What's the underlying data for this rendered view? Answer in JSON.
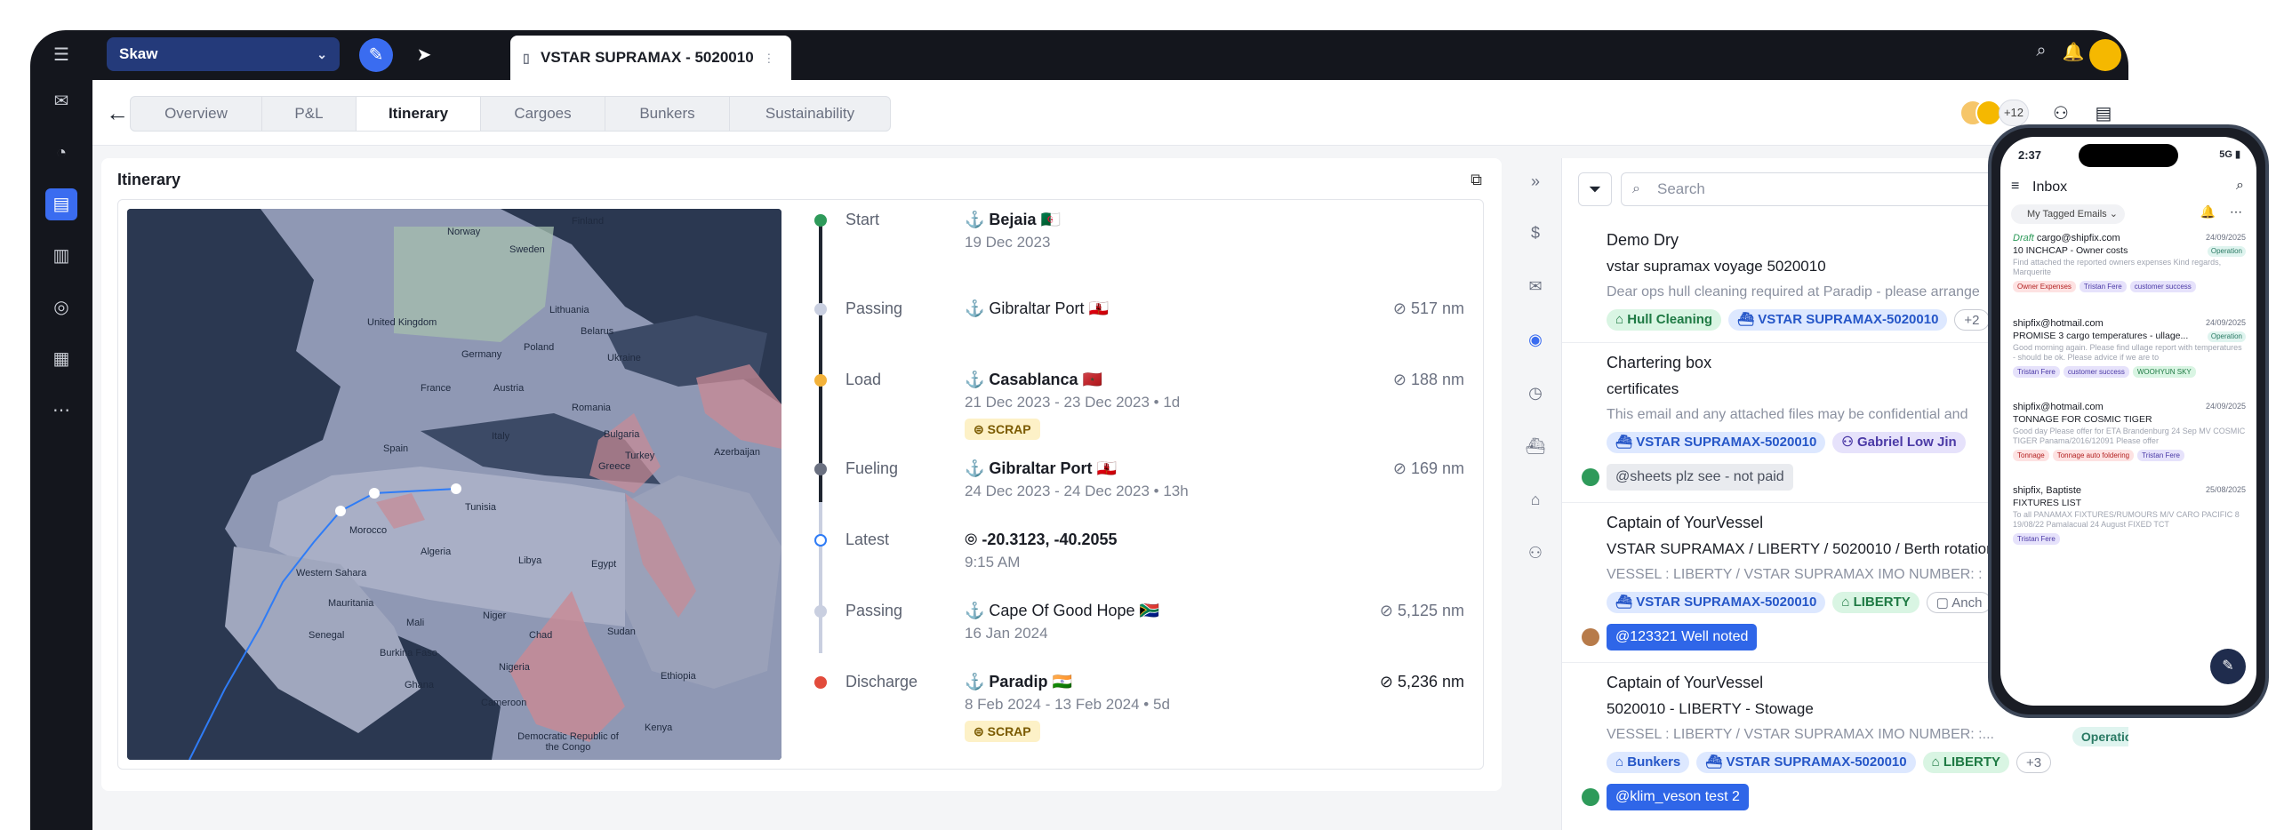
{
  "topbar": {
    "workspace": "Skaw",
    "tab_title": "VSTAR SUPRAMAX - 5020010",
    "tab_extra": "⋮"
  },
  "subnav": {
    "tabs": [
      "Overview",
      "P&L",
      "Itinerary",
      "Cargoes",
      "Bunkers",
      "Sustainability"
    ],
    "active_tab": "Itinerary",
    "participants_more": "+12"
  },
  "itinerary": {
    "title": "Itinerary",
    "map_labels": [
      "Finland",
      "Norway",
      "Sweden",
      "United Kingdom",
      "Lithuania",
      "Belarus",
      "Poland",
      "Germany",
      "Ukraine",
      "France",
      "Austria",
      "Romania",
      "Bulgaria",
      "Italy",
      "Spain",
      "Greece",
      "Turkey",
      "Azerbaijan",
      "Tunisia",
      "Morocco",
      "Algeria",
      "Libya",
      "Egypt",
      "Western Sahara",
      "Mauritania",
      "Mali",
      "Niger",
      "Chad",
      "Sudan",
      "Senegal",
      "Burkina Faso",
      "Nigeria",
      "Ghana",
      "Cameroon",
      "Ethiopia",
      "Kenya",
      "Democratic Republic of the Congo"
    ],
    "stops": [
      {
        "label": "Start",
        "place": "Bejaia",
        "flag": "🇩🇿",
        "date": "19 Dec 2023",
        "dist": "",
        "badge": ""
      },
      {
        "label": "Passing",
        "place": "Gibraltar Port",
        "flag": "🇬🇮",
        "date": "",
        "dist": "517 nm",
        "badge": ""
      },
      {
        "label": "Load",
        "place": "Casablanca",
        "flag": "🇲🇦",
        "date": "21 Dec 2023 - 23 Dec 2023 • 1d",
        "dist": "188 nm",
        "badge": "SCRAP"
      },
      {
        "label": "Fueling",
        "place": "Gibraltar Port",
        "flag": "🇬🇮",
        "date": "24 Dec 2023 - 24 Dec 2023 • 13h",
        "dist": "169 nm",
        "badge": ""
      },
      {
        "label": "Latest",
        "place": "-20.3123, -40.2055",
        "flag": "",
        "date": "9:15 AM",
        "dist": "",
        "badge": ""
      },
      {
        "label": "Passing",
        "place": "Cape Of Good Hope",
        "flag": "🇿🇦",
        "date": "16 Jan 2024",
        "dist": "5,125 nm",
        "badge": ""
      },
      {
        "label": "Discharge",
        "place": "Paradip",
        "flag": "🇮🇳",
        "date": "8 Feb 2024 - 13 Feb 2024 • 5d",
        "dist": "5,236 nm",
        "badge": "SCRAP"
      }
    ]
  },
  "inbox": {
    "search_placeholder": "Search",
    "emails": [
      {
        "from": "Demo Dry",
        "subject": "vstar supramax voyage 5020010",
        "preview": "Dear ops hull cleaning required at Paradip - please arrange",
        "chips": [
          "Hull Cleaning",
          "VSTAR SUPRAMAX-5020010",
          "+2"
        ],
        "comment": ""
      },
      {
        "from": "Chartering box",
        "subject": "certificates",
        "preview": "This email and any attached files may be confidential and",
        "chips": [
          "VSTAR SUPRAMAX-5020010",
          "Gabriel Low Jin"
        ],
        "comment": "@sheets plz see - not paid"
      },
      {
        "from": "Captain of YourVessel",
        "subject": "VSTAR SUPRAMAX / LIBERTY / 5020010 / Berth rotation",
        "preview": "VESSEL : LIBERTY / VSTAR SUPRAMAX IMO NUMBER: :",
        "chips": [
          "VSTAR SUPRAMAX-5020010",
          "LIBERTY",
          "Anch"
        ],
        "comment": "@123321 Well noted"
      },
      {
        "from": "Captain of YourVessel",
        "subject": "5020010 - LIBERTY - Stowage",
        "preview": "VESSEL : LIBERTY / VSTAR SUPRAMAX IMO NUMBER: :...",
        "chips": [
          "Bunkers",
          "VSTAR SUPRAMAX-5020010",
          "LIBERTY",
          "+3"
        ],
        "comment": "@klim_veson test 2",
        "status": "Operation"
      }
    ]
  },
  "phone": {
    "time": "2:37",
    "network": "5G",
    "title": "Inbox",
    "filter": "My Tagged Emails",
    "messages": [
      {
        "draft": "Draft",
        "from": "cargo@shipfix.com",
        "date": "24/09/2025",
        "subject": "10 INCHCAP - Owner costs",
        "status": "Operation",
        "preview": "Find attached the reported owners expenses Kind regards, Marquerite",
        "chips": [
          "Owner Expenses",
          "Tristan Fere",
          "customer success"
        ]
      },
      {
        "draft": "",
        "from": "shipfix@hotmail.com",
        "date": "24/09/2025",
        "subject": "PROMISE 3 cargo temperatures - ullage...",
        "status": "Operation",
        "preview": "Good morning again. Please find ullage report with temperatures - should be ok. Please advice if we are to",
        "chips": [
          "Tristan Fere",
          "customer success",
          "WOOHYUN SKY"
        ]
      },
      {
        "draft": "",
        "from": "shipfix@hotmail.com",
        "date": "24/09/2025",
        "subject": "TONNAGE FOR COSMIC TIGER",
        "status": "",
        "preview": "Good day Please offer for ETA Brandenburg 24 Sep MV COSMIC TIGER Panama/2016/12091 Please offer",
        "chips": [
          "Tonnage",
          "Tonnage auto foldering",
          "Tristan Fere"
        ]
      },
      {
        "draft": "",
        "from": "shipfix, Baptiste",
        "date": "25/08/2025",
        "subject": "FIXTURES LIST",
        "status": "",
        "preview": "To all PANAMAX FIXTURES/RUMOURS M/V CARO PACIFIC 8 19/08/22 Pamalacual 24 August FIXED TCT",
        "chips": [
          "Tristan Fere"
        ]
      }
    ]
  }
}
